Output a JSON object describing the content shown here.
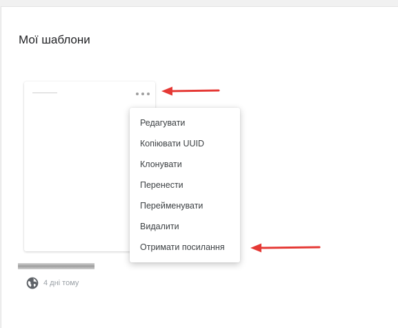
{
  "page": {
    "title": "Мої шаблони"
  },
  "template_card": {
    "menu_button_icon": "more-horizontal-icon",
    "visibility_icon": "globe-icon",
    "modified": "4 дні тому"
  },
  "context_menu": {
    "items": [
      {
        "label": "Редагувати"
      },
      {
        "label": "Копіювати UUID"
      },
      {
        "label": "Клонувати"
      },
      {
        "label": "Перенести"
      },
      {
        "label": "Перейменувати"
      },
      {
        "label": "Видалити"
      },
      {
        "label": "Отримати посилання"
      }
    ]
  },
  "annotations": {
    "arrow_color": "#e53935"
  },
  "colors": {
    "background": "#f1f1f1",
    "surface": "#ffffff",
    "text": "#3c4043",
    "muted": "#9aa0a6"
  }
}
